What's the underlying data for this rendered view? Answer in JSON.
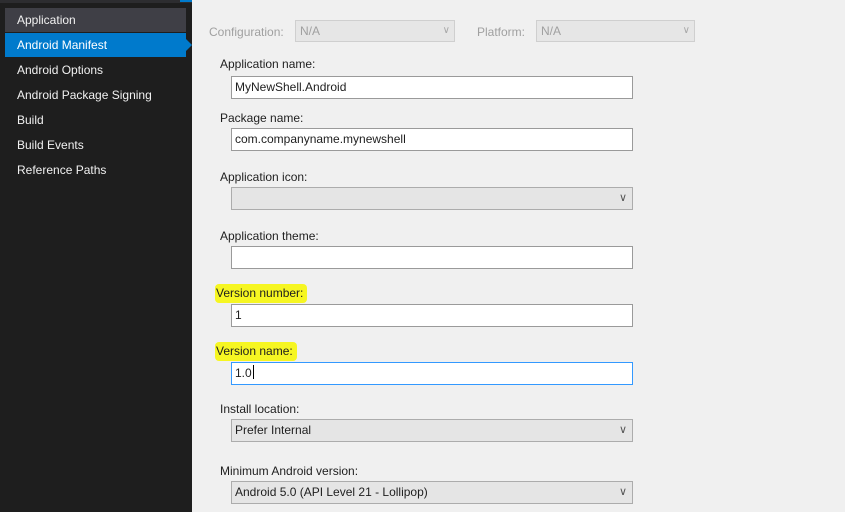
{
  "sidebar": {
    "items": [
      {
        "label": "Application"
      },
      {
        "label": "Android Manifest"
      },
      {
        "label": "Android Options"
      },
      {
        "label": "Android Package Signing"
      },
      {
        "label": "Build"
      },
      {
        "label": "Build Events"
      },
      {
        "label": "Reference Paths"
      }
    ]
  },
  "config_bar": {
    "configuration_label": "Configuration:",
    "configuration_value": "N/A",
    "platform_label": "Platform:",
    "platform_value": "N/A"
  },
  "form": {
    "application_name_label": "Application name:",
    "application_name_value": "MyNewShell.Android",
    "package_name_label": "Package name:",
    "package_name_value": "com.companyname.mynewshell",
    "application_icon_label": "Application icon:",
    "application_icon_value": "",
    "application_theme_label": "Application theme:",
    "application_theme_value": "",
    "version_number_label": "Version number:",
    "version_number_value": "1",
    "version_name_label": "Version name:",
    "version_name_value": "1.0",
    "install_location_label": "Install location:",
    "install_location_value": "Prefer Internal",
    "min_android_label": "Minimum Android version:",
    "min_android_value": "Android 5.0 (API Level 21 - Lollipop)"
  },
  "colors": {
    "sidebar_bg": "#1e1e1e",
    "selected_item": "#007acc",
    "highlight": "#f6f622",
    "content_bg": "#f0f0f0"
  },
  "icons": {
    "dropdown": "chevron-down-icon"
  }
}
